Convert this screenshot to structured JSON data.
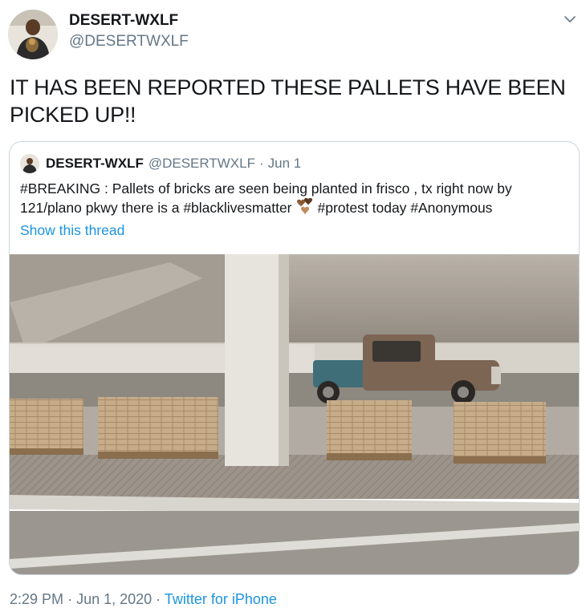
{
  "tweet": {
    "display_name": "DESERT-WXLF",
    "handle": "@DESERTWXLF",
    "text_line1": "IT HAS BEEN REPORTED THESE PALLETS HAVE BEEN",
    "text_line2": "PICKED UP!!",
    "time": "2:29 PM",
    "date": "Jun 1, 2020",
    "source": "Twitter for iPhone",
    "separator": "·"
  },
  "quoted": {
    "display_name": "DESERT-WXLF",
    "handle": "@DESERTWXLF",
    "separator": "·",
    "date": "Jun 1",
    "text_part1": "#BREAKING : Pallets of bricks are seen being planted in frisco , tx right now by",
    "text_part2": "121/plano pkwy there is a #blacklivesmatter",
    "text_part3": "#protest today #Anonymous",
    "show_thread": "Show this thread"
  },
  "icons": {
    "caret": "chevron-down-icon",
    "emoji": "brown-hearts-emoji"
  },
  "colors": {
    "link": "#1b95e0",
    "secondary_text": "#657786",
    "border": "#ccd6dd"
  }
}
